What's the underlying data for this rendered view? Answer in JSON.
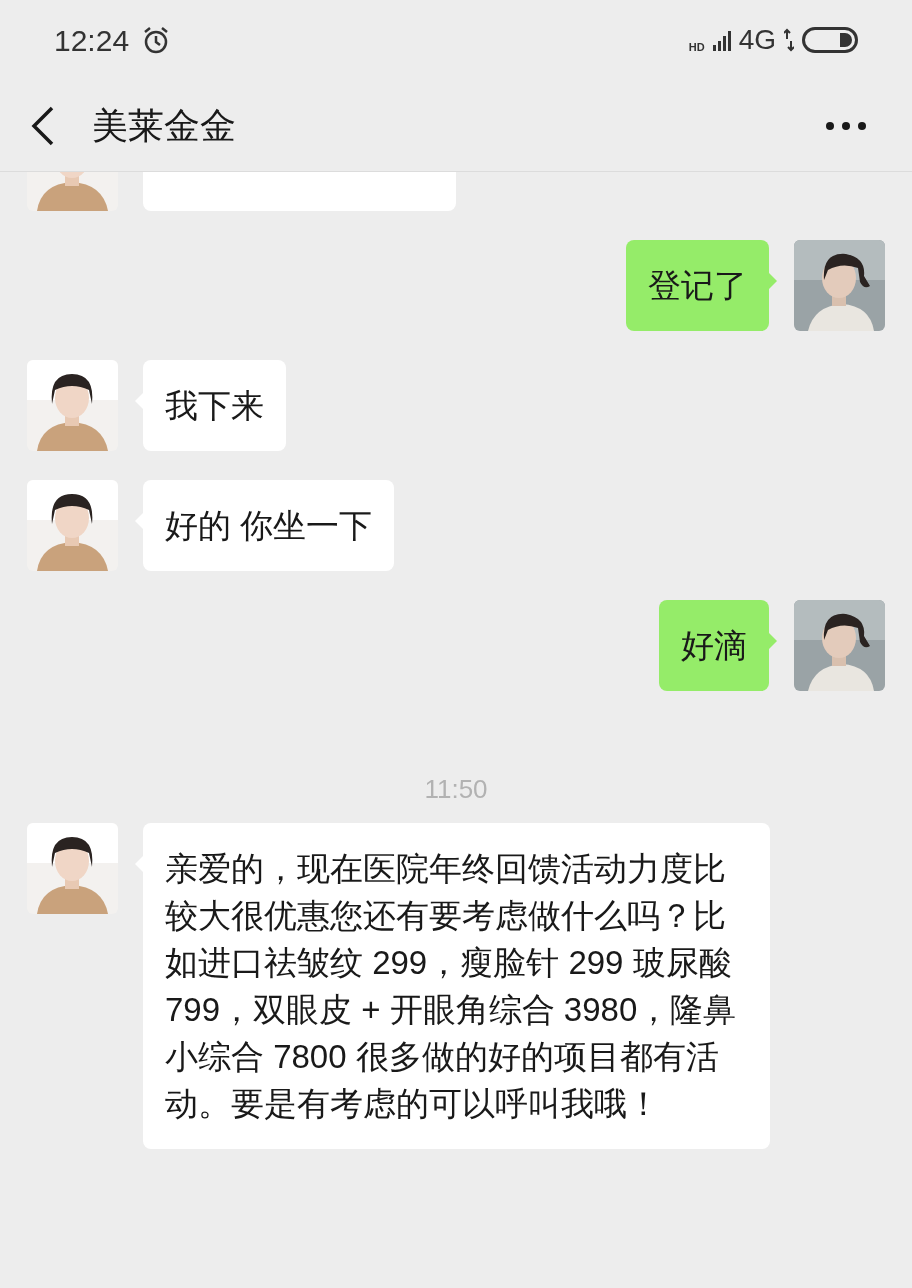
{
  "status_bar": {
    "time": "12:24",
    "hd": "HD",
    "network": "4G"
  },
  "header": {
    "title": "美莱金金"
  },
  "messages": [
    {
      "kind": "cut_off",
      "outgoing": false
    },
    {
      "kind": "text",
      "outgoing": true,
      "text": "登记了"
    },
    {
      "kind": "text",
      "outgoing": false,
      "text": "我下来"
    },
    {
      "kind": "text",
      "outgoing": false,
      "text": "好的 你坐一下"
    },
    {
      "kind": "text",
      "outgoing": true,
      "text": "好滴"
    },
    {
      "kind": "time",
      "text": "11:50"
    },
    {
      "kind": "text",
      "outgoing": false,
      "text": "亲爱的，现在医院年终回馈活动力度比较大很优惠您还有要考虑做什么吗？比如进口祛皱纹 299，瘦脸针 299 玻尿酸 799，双眼皮 + 开眼角综合 3980，隆鼻小综合 7800 很多做的好的项目都有活动。要是有考虑的可以呼叫我哦！"
    }
  ]
}
